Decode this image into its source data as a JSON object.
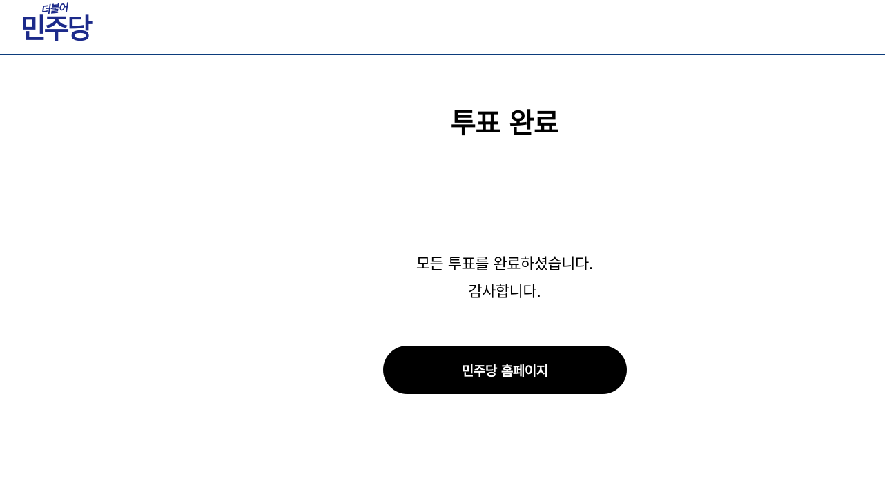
{
  "header": {
    "logo_small": "더불어",
    "logo_big": "민주당",
    "border_color": "#0c3c7c",
    "logo_color": "#1c2a8a"
  },
  "main": {
    "title": "투표 완료",
    "message_line1": "모든 투표를 완료하셨습니다.",
    "message_line2": "감사합니다.",
    "home_button_label": "민주당 홈페이지",
    "button_color": "#000000"
  }
}
